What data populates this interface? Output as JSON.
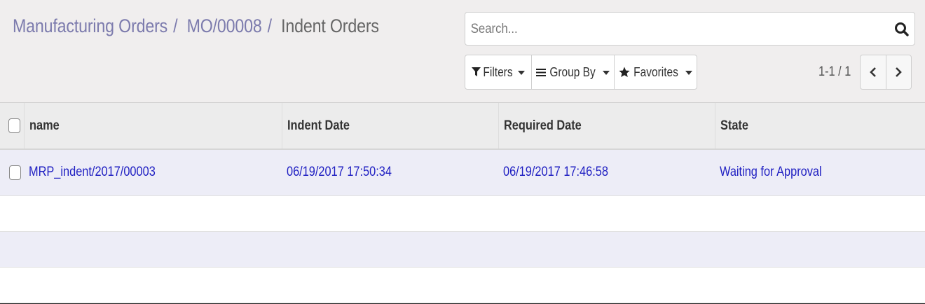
{
  "breadcrumb": {
    "items": [
      {
        "label": "Manufacturing Orders"
      },
      {
        "label": "MO/00008"
      }
    ],
    "separator": "/",
    "current": "Indent Orders"
  },
  "search": {
    "placeholder": "Search...",
    "value": ""
  },
  "search_options": {
    "filters_label": "Filters",
    "group_by_label": "Group By",
    "favorites_label": "Favorites"
  },
  "pager": {
    "value": "1-1 / 1"
  },
  "table": {
    "columns": [
      "name",
      "Indent Date",
      "Required Date",
      "State"
    ],
    "rows": [
      {
        "name": "MRP_indent/2017/00003",
        "indent_date": "06/19/2017 17:50:34",
        "required_date": "06/19/2017 17:46:58",
        "state": "Waiting for Approval"
      }
    ]
  },
  "colors": {
    "breadcrumb_link": "#7c7bad",
    "row_link": "#1f1fc2",
    "control_panel_bg": "#f0eeee",
    "row_stripe": "#ededf7"
  },
  "icons": {
    "search": "magnifier-icon",
    "filters": "funnel-icon",
    "group_by": "bars-icon",
    "favorites": "star-icon",
    "prev": "chevron-left-icon",
    "next": "chevron-right-icon"
  }
}
